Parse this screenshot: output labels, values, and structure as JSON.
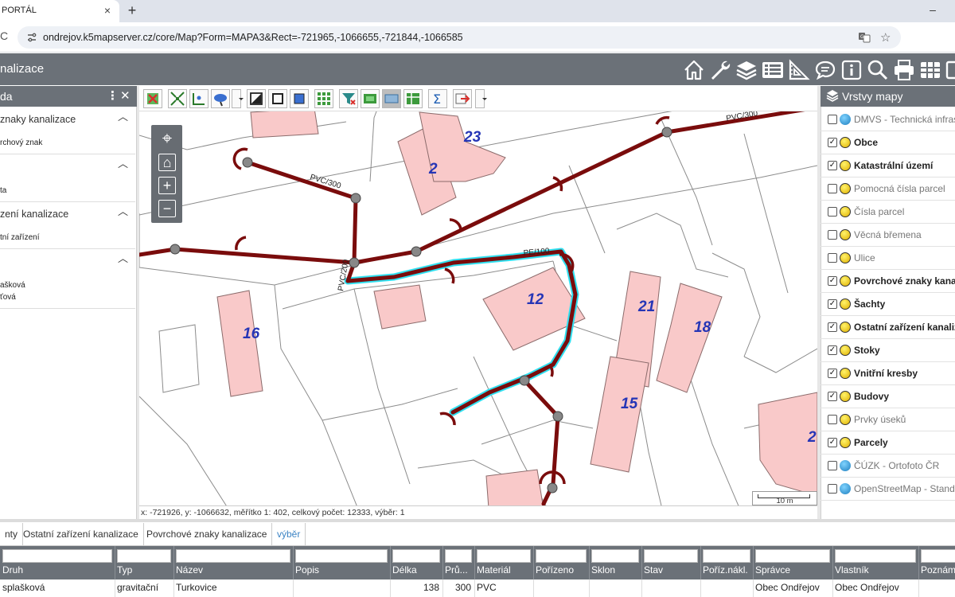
{
  "browser": {
    "tab_title": "PORTÁL",
    "tab_close": "×",
    "new_tab": "+",
    "minimize": "–",
    "url": "ondrejov.k5mapserver.cz/core/Map?Form=MAPA3&Rect=-721965,-1066655,-721844,-1066585",
    "reload": "C"
  },
  "app": {
    "title": "nalizace",
    "toolbar_icons": [
      "home-icon",
      "wrench-icon",
      "layers-icon",
      "list-icon",
      "ruler-triangle-icon",
      "chat-icon",
      "info-icon",
      "search-icon",
      "print-icon",
      "grid-icon"
    ]
  },
  "left_panel": {
    "title": "da",
    "kebab": "⋮",
    "close": "✕",
    "sections": [
      {
        "title": "znaky kanalizace",
        "item": "rchový znak"
      },
      {
        "title": "",
        "item": "ta"
      },
      {
        "title": "zení kanalizace",
        "item": "tní zařízení"
      },
      {
        "title": "",
        "items": [
          "ašková",
          "ťová"
        ]
      }
    ]
  },
  "map": {
    "labels": {
      "pipe_pvc_300_a": "PVC/300",
      "pipe_pvc_300_b": "PVC/300",
      "pipe_pvc_200": "PVC/200",
      "pipe_pe_100": "PE/100"
    },
    "buildings": [
      "23",
      "2",
      "12",
      "21",
      "18",
      "16",
      "15",
      "2"
    ],
    "status": "x: -721926, y: -1066632, měřítko 1: 402, celkový počet: 12333, výběr: 1",
    "scale_label": "10 m",
    "nav": {
      "locate": "⌖",
      "home": "⌂",
      "zoom_in": "+",
      "zoom_out": "−"
    }
  },
  "right_panel": {
    "title": "Vrstvy mapy",
    "layers": [
      {
        "label": "DMVS - Technická infrastr",
        "checked": false,
        "bold": false,
        "icon": "globe"
      },
      {
        "label": "Obce",
        "checked": true,
        "bold": true,
        "icon": "yellow"
      },
      {
        "label": "Katastrální území",
        "checked": true,
        "bold": true,
        "icon": "yellow"
      },
      {
        "label": "Pomocná čísla parcel",
        "checked": false,
        "bold": false,
        "icon": "yellow"
      },
      {
        "label": "Čísla parcel",
        "checked": false,
        "bold": false,
        "icon": "yellow"
      },
      {
        "label": "Věcná břemena",
        "checked": false,
        "bold": false,
        "icon": "yellow"
      },
      {
        "label": "Ulice",
        "checked": false,
        "bold": false,
        "icon": "yellow"
      },
      {
        "label": "Povrchové znaky kanaliz",
        "checked": true,
        "bold": true,
        "icon": "yellow"
      },
      {
        "label": "Šachty",
        "checked": true,
        "bold": true,
        "icon": "yellow"
      },
      {
        "label": "Ostatní zařízení kanaliz",
        "checked": true,
        "bold": true,
        "icon": "yellow"
      },
      {
        "label": "Stoky",
        "checked": true,
        "bold": true,
        "icon": "yellow"
      },
      {
        "label": "Vnitřní kresby",
        "checked": true,
        "bold": true,
        "icon": "yellow"
      },
      {
        "label": "Budovy",
        "checked": true,
        "bold": true,
        "icon": "yellow"
      },
      {
        "label": "Prvky úseků",
        "checked": false,
        "bold": false,
        "icon": "yellow"
      },
      {
        "label": "Parcely",
        "checked": true,
        "bold": true,
        "icon": "yellow"
      },
      {
        "label": "ČÚZK - Ortofoto ČR",
        "checked": false,
        "bold": false,
        "icon": "globe"
      },
      {
        "label": "OpenStreetMap - Standar",
        "checked": false,
        "bold": false,
        "icon": "globe"
      }
    ]
  },
  "bottom": {
    "tabs": [
      "nty",
      "Ostatní zařízení kanalizace",
      "Povrchové znaky kanalizace",
      "výběr"
    ],
    "columns": [
      "Druh",
      "Typ",
      "Název",
      "Popis",
      "Délka",
      "Prů...",
      "Materiál",
      "Pořízeno",
      "Sklon",
      "Stav",
      "Poříz.nákl.",
      "Správce",
      "Vlastník",
      "Poznám"
    ],
    "row": [
      "splašková",
      "gravitační",
      "Turkovice",
      "",
      "138",
      "300",
      "PVC",
      "",
      "",
      "",
      "",
      "Obec Ondřejov",
      "Obec Ondřejov",
      ""
    ]
  },
  "colors": {
    "header_bg": "#6b7178",
    "pipe": "#7a0c0c",
    "selection": "#30e0f0",
    "building_fill": "#f9c9c9",
    "accent_tab": "#3b83c4"
  }
}
